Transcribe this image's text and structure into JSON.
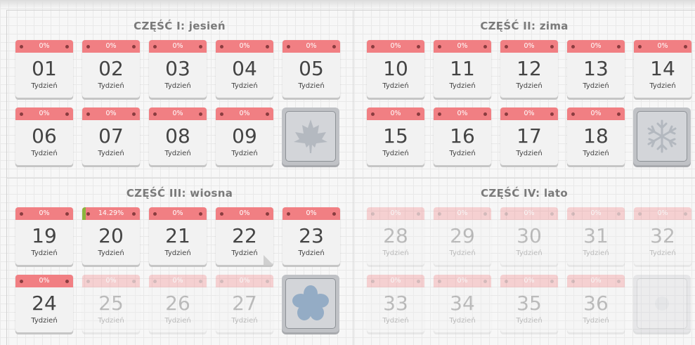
{
  "sections": [
    {
      "title": "CZĘŚĆ I: jesień",
      "cards": [
        {
          "num": "01",
          "pct": "0%"
        },
        {
          "num": "02",
          "pct": "0%"
        },
        {
          "num": "03",
          "pct": "0%"
        },
        {
          "num": "04",
          "pct": "0%"
        },
        {
          "num": "05",
          "pct": "0%"
        },
        {
          "num": "06",
          "pct": "0%"
        },
        {
          "num": "07",
          "pct": "0%"
        },
        {
          "num": "08",
          "pct": "0%"
        },
        {
          "num": "09",
          "pct": "0%"
        }
      ],
      "bonus_icon": "maple-leaf-icon"
    },
    {
      "title": "CZĘŚĆ II: zima",
      "cards": [
        {
          "num": "10",
          "pct": "0%"
        },
        {
          "num": "11",
          "pct": "0%"
        },
        {
          "num": "12",
          "pct": "0%"
        },
        {
          "num": "13",
          "pct": "0%"
        },
        {
          "num": "14",
          "pct": "0%"
        },
        {
          "num": "15",
          "pct": "0%"
        },
        {
          "num": "16",
          "pct": "0%"
        },
        {
          "num": "17",
          "pct": "0%"
        },
        {
          "num": "18",
          "pct": "0%"
        }
      ],
      "bonus_icon": "snowflake-icon"
    },
    {
      "title": "CZĘŚĆ III: wiosna",
      "cards": [
        {
          "num": "19",
          "pct": "0%"
        },
        {
          "num": "20",
          "pct": "14.29%"
        },
        {
          "num": "21",
          "pct": "0%"
        },
        {
          "num": "22",
          "pct": "0%"
        },
        {
          "num": "23",
          "pct": "0%"
        },
        {
          "num": "24",
          "pct": "0%"
        },
        {
          "num": "25",
          "pct": "0%"
        },
        {
          "num": "26",
          "pct": "0%"
        },
        {
          "num": "27",
          "pct": "0%"
        }
      ],
      "bonus_icon": "flower-icon"
    },
    {
      "title": "CZĘŚĆ IV: lato",
      "cards": [
        {
          "num": "28",
          "pct": "0%"
        },
        {
          "num": "29",
          "pct": "0%"
        },
        {
          "num": "30",
          "pct": "0%"
        },
        {
          "num": "31",
          "pct": "0%"
        },
        {
          "num": "32",
          "pct": "0%"
        },
        {
          "num": "33",
          "pct": "0%"
        },
        {
          "num": "34",
          "pct": "0%"
        },
        {
          "num": "35",
          "pct": "0%"
        },
        {
          "num": "36",
          "pct": "0%"
        }
      ],
      "bonus_icon": "sun-icon"
    }
  ],
  "card_label": "Tydzień",
  "colors": {
    "header": "#f17f83",
    "progress_accent": "#8bb53c",
    "card": "#f2f2f2",
    "bonus": "#c0c2c6"
  }
}
